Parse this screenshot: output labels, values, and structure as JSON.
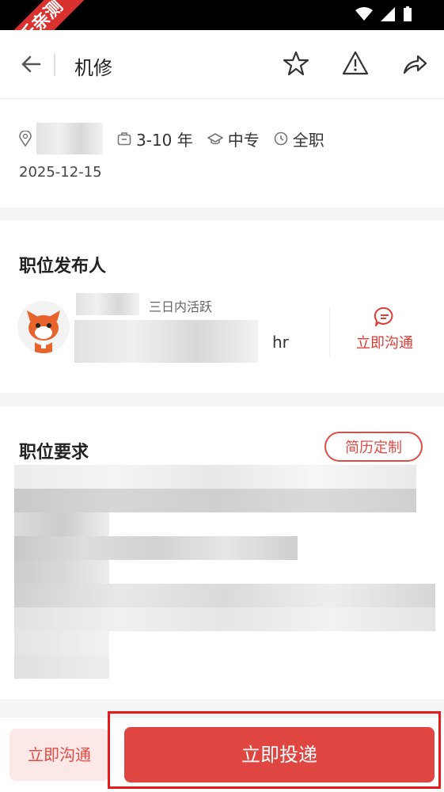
{
  "ribbon": {
    "text": "乐乐亲测"
  },
  "header": {
    "title": "机修"
  },
  "job": {
    "experience": "3-10 年",
    "education": "中专",
    "type": "全职",
    "date": "2025-12-15"
  },
  "publisher": {
    "section_title": "职位发布人",
    "activity": "三日内活跃",
    "role": "hr",
    "chat_label": "立即沟通"
  },
  "requirements": {
    "section_title": "职位要求",
    "resume_btn": "简历定制"
  },
  "bottom": {
    "chat_label": "立即沟通",
    "apply_label": "立即投递"
  },
  "colors": {
    "accent": "#df4541",
    "ribbon": "#d9312d"
  }
}
